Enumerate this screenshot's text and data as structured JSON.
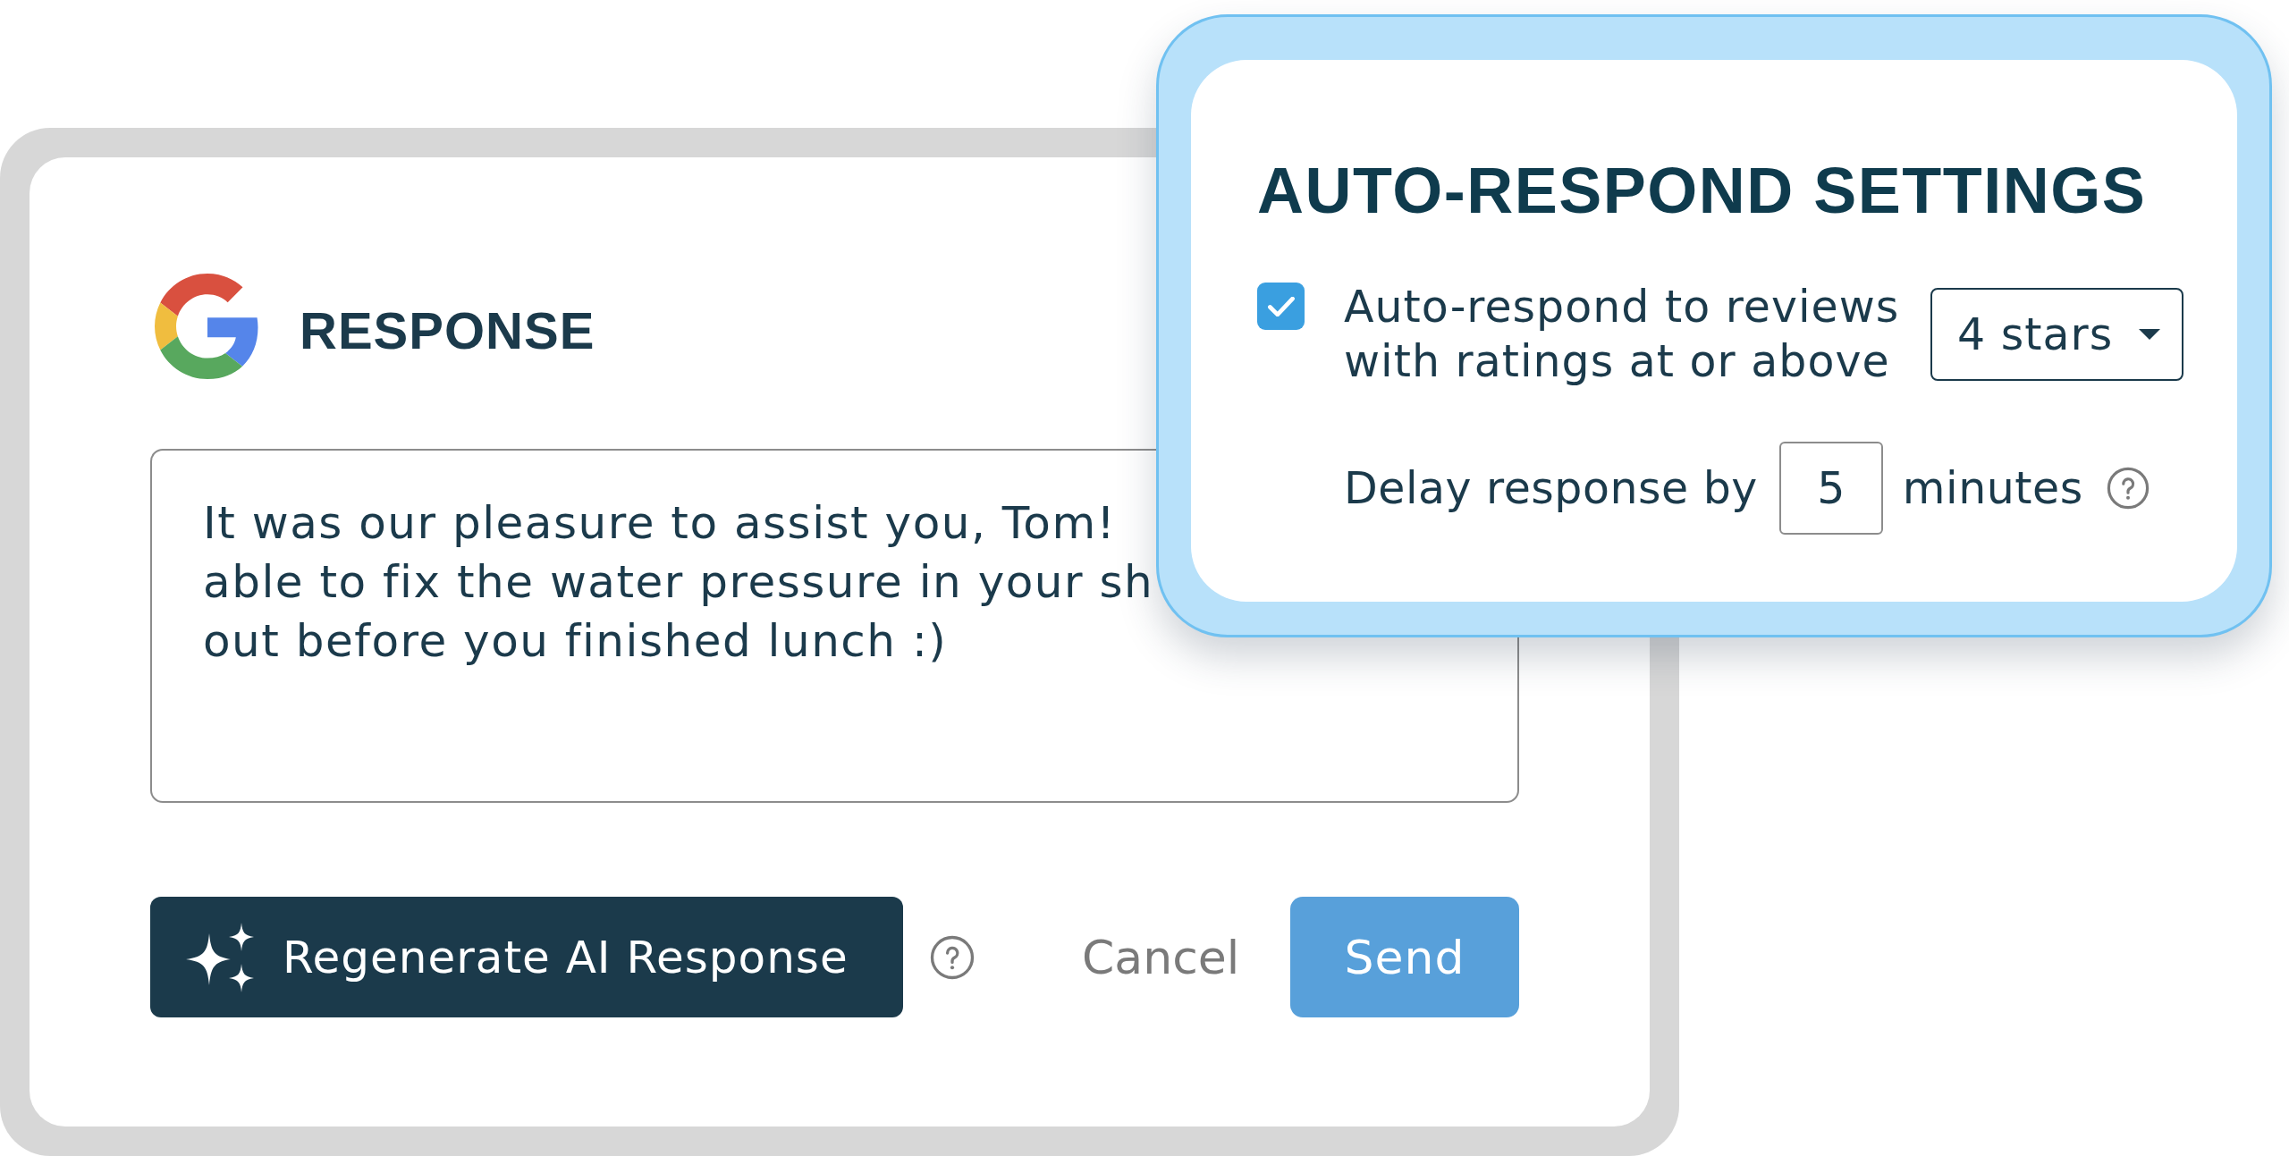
{
  "response_card": {
    "title": "RESPONSE",
    "reply_lines": [
      "It was our pleasure to assist you, Tom!",
      "able to fix the water pressure in your sh",
      "out before you finished lunch :)"
    ],
    "actions": [
      {
        "kind": "ai",
        "label": "Regenerate AI Response"
      },
      {
        "kind": "help"
      },
      {
        "kind": "link",
        "label": "Cancel"
      },
      {
        "kind": "primary",
        "label": "Send"
      }
    ]
  },
  "settings": {
    "title": "AUTO-RESPOND SETTINGS",
    "auto_respond": {
      "checked": true,
      "label": "Auto-respond to reviews with ratings at or above",
      "min_rating": "4 stars"
    },
    "delay": {
      "label": "Delay response by",
      "value": "5",
      "unit": "minutes"
    }
  }
}
